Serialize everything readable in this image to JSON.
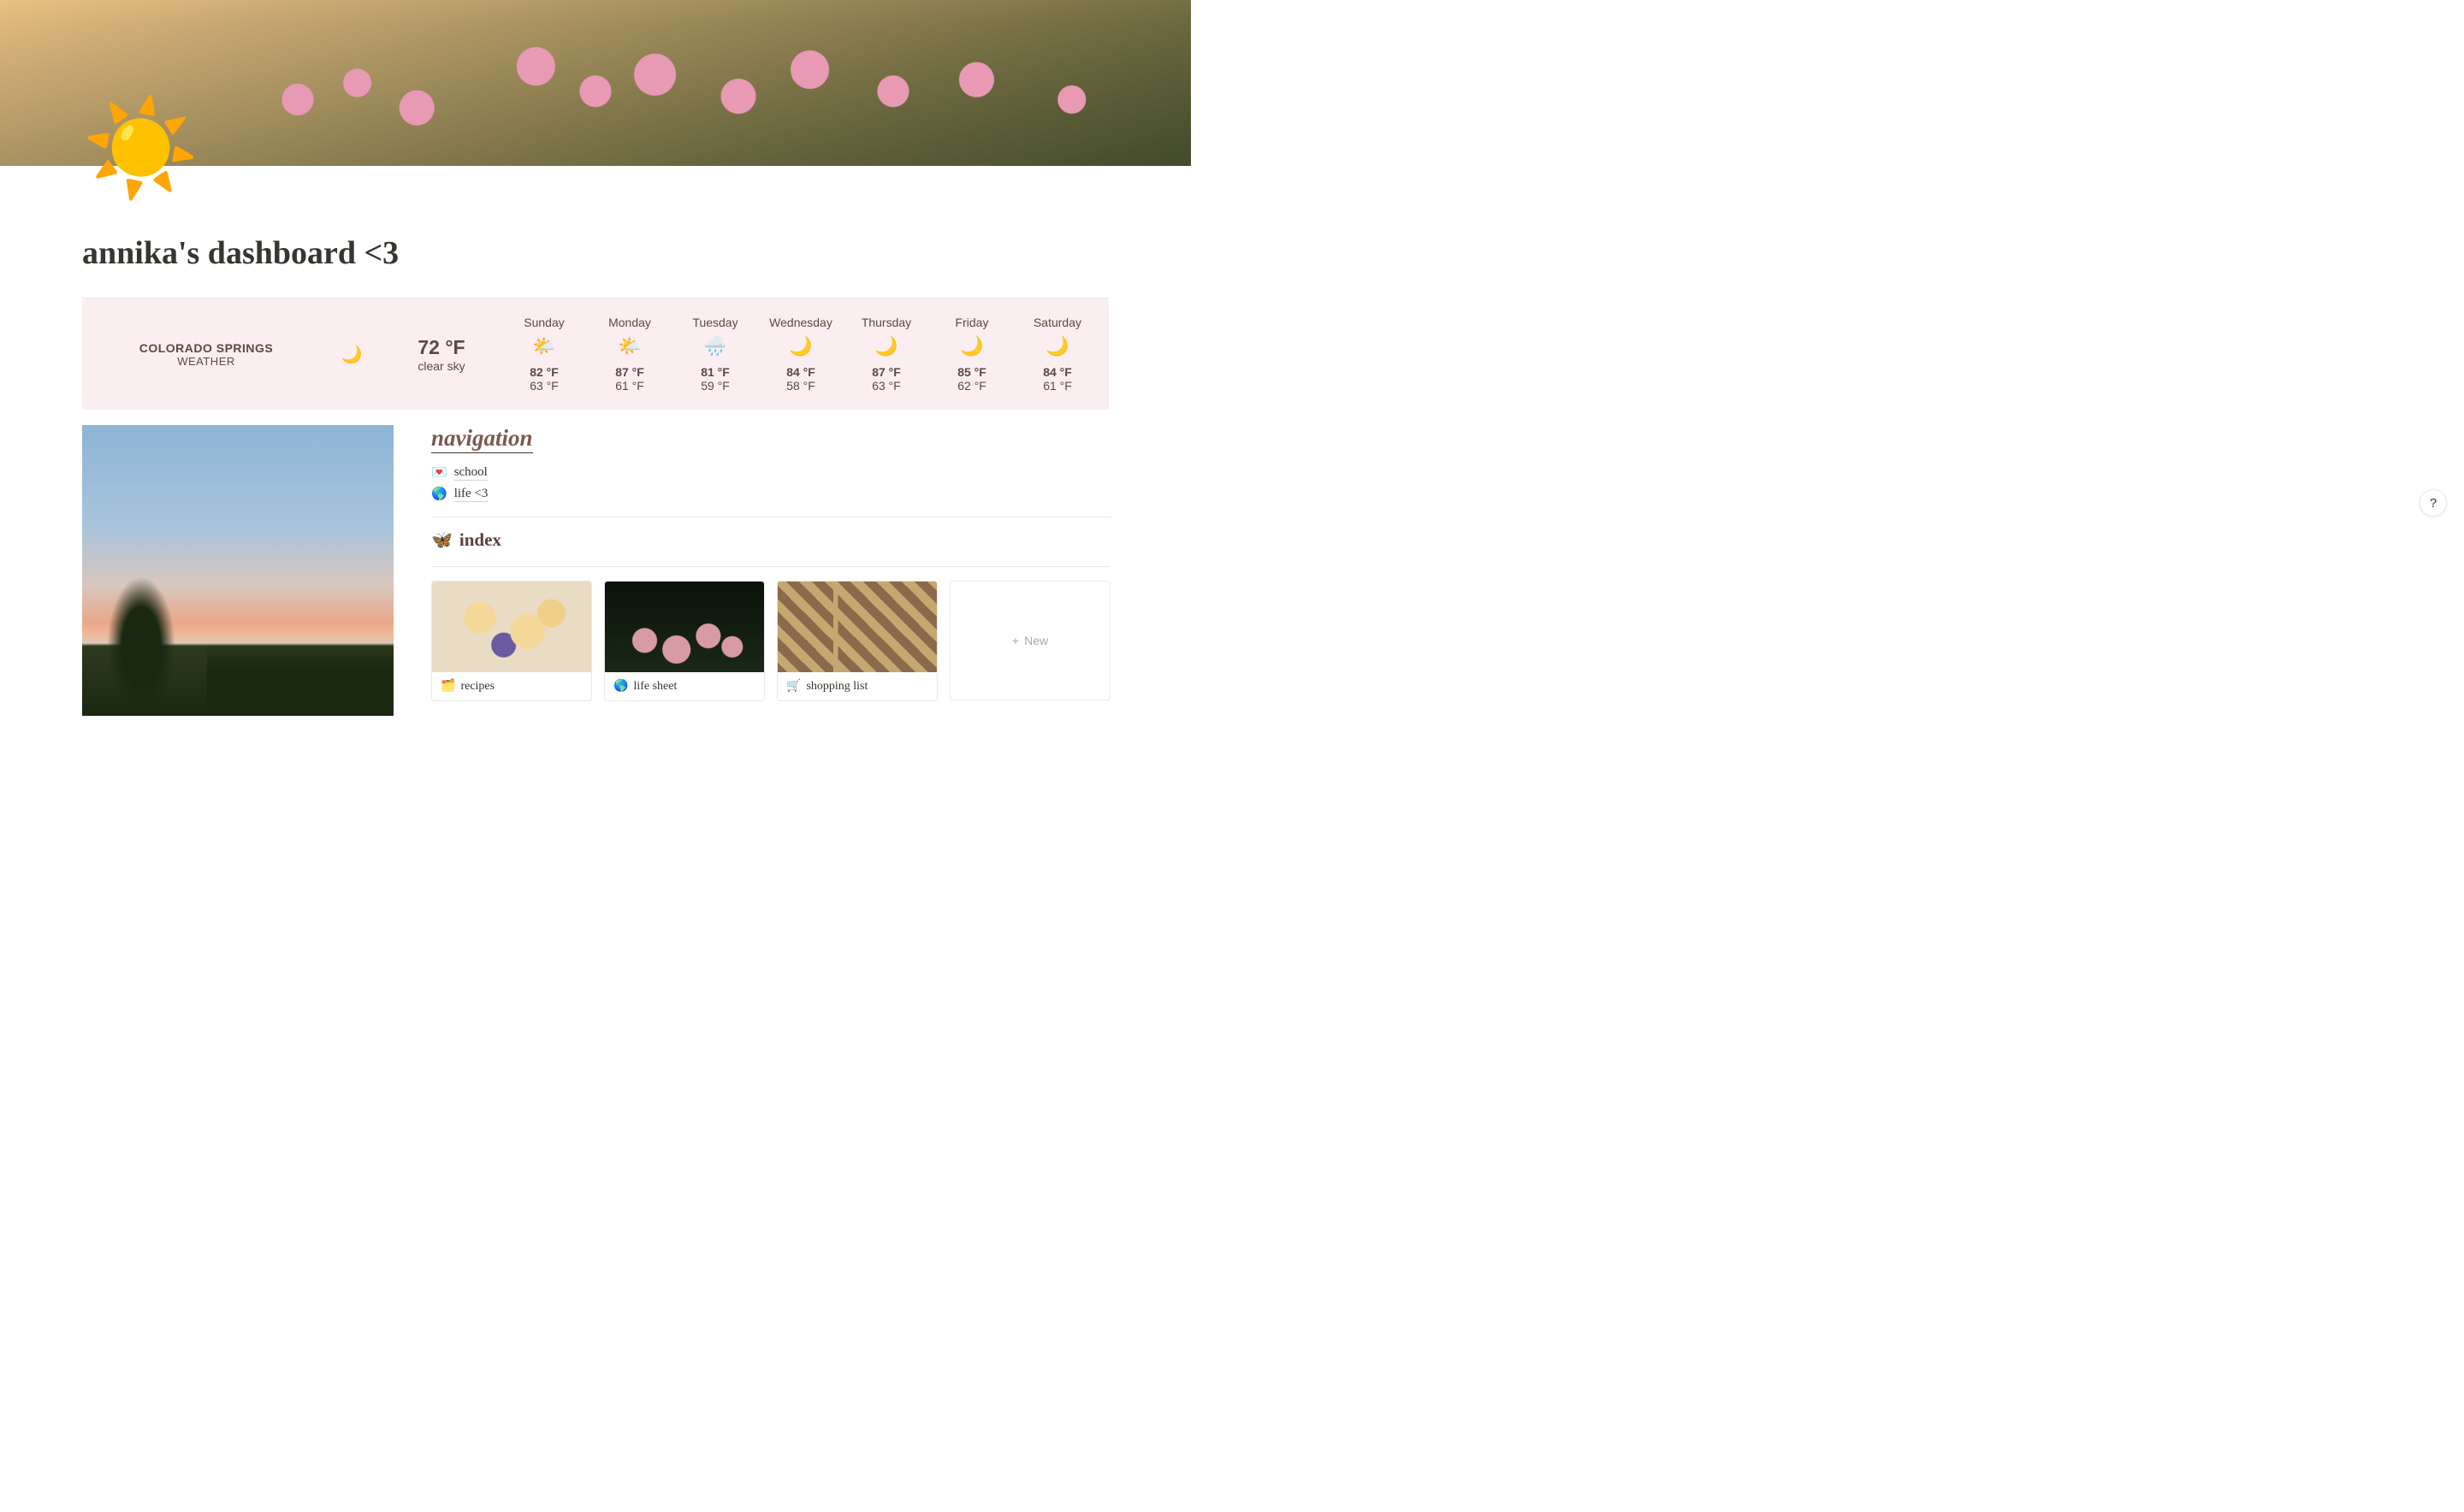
{
  "page": {
    "title": "annika's dashboard <3",
    "icon": "☀️"
  },
  "weather": {
    "city": "COLORADO SPRINGS",
    "label": "WEATHER",
    "now_icon": "🌙",
    "now_temp": "72 °F",
    "now_desc": "clear sky",
    "days": [
      {
        "name": "Sunday",
        "icon": "🌤️",
        "hi": "82 °F",
        "lo": "63 °F"
      },
      {
        "name": "Monday",
        "icon": "🌤️",
        "hi": "87 °F",
        "lo": "61 °F"
      },
      {
        "name": "Tuesday",
        "icon": "🌧️",
        "hi": "81 °F",
        "lo": "59 °F"
      },
      {
        "name": "Wednesday",
        "icon": "🌙",
        "hi": "84 °F",
        "lo": "58 °F"
      },
      {
        "name": "Thursday",
        "icon": "🌙",
        "hi": "87 °F",
        "lo": "63 °F"
      },
      {
        "name": "Friday",
        "icon": "🌙",
        "hi": "85 °F",
        "lo": "62 °F"
      },
      {
        "name": "Saturday",
        "icon": "🌙",
        "hi": "84 °F",
        "lo": "61 °F"
      }
    ]
  },
  "navigation": {
    "heading": "navigation",
    "links": [
      {
        "emoji": "💌",
        "label": "school"
      },
      {
        "emoji": "🌎",
        "label": "life <3"
      }
    ]
  },
  "index": {
    "emoji": "🦋",
    "heading": "index",
    "cards": [
      {
        "emoji": "🗂️",
        "label": "recipes"
      },
      {
        "emoji": "🌎",
        "label": "life sheet"
      },
      {
        "emoji": "🛒",
        "label": "shopping list"
      }
    ],
    "new_label": "New"
  },
  "help_label": "?"
}
